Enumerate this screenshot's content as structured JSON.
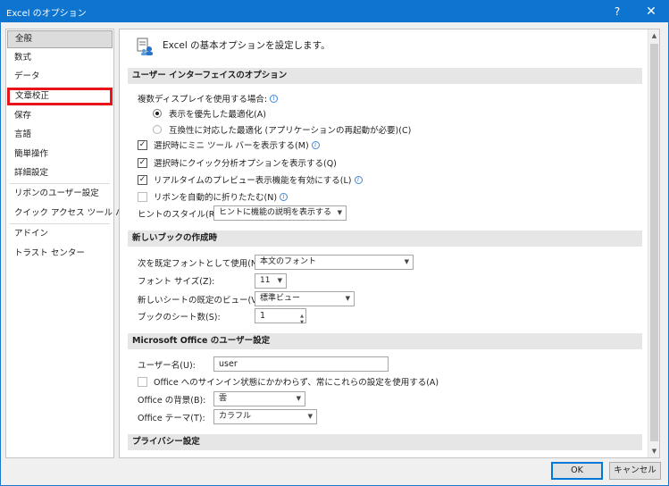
{
  "window": {
    "title": "Excel のオプション",
    "help_glyph": "?",
    "close_glyph": "✕"
  },
  "sidebar": {
    "items": [
      {
        "label": "全般",
        "selected": true
      },
      {
        "label": "数式"
      },
      {
        "label": "データ"
      },
      {
        "label": "文章校正",
        "highlighted": true
      },
      {
        "label": "保存"
      },
      {
        "label": "言語"
      },
      {
        "label": "簡単操作"
      },
      {
        "label": "詳細設定"
      },
      {
        "label": "リボンのユーザー設定"
      },
      {
        "label": "クイック アクセス ツール バー"
      },
      {
        "label": "アドイン"
      },
      {
        "label": "トラスト センター"
      }
    ]
  },
  "content": {
    "header": "Excel の基本オプションを設定します。",
    "ui_section": {
      "title": "ユーザー インターフェイスのオプション",
      "multi_display_label": "複数ディスプレイを使用する場合:",
      "radio_optimize_display": "表示を優先した最適化(A)",
      "radio_optimize_compat": "互換性に対応した最適化 (アプリケーションの再起動が必要)(C)",
      "mini_toolbar": "選択時にミニ ツール バーを表示する(M)",
      "quick_analysis": "選択時にクイック分析オプションを表示する(Q)",
      "live_preview": "リアルタイムのプレビュー表示機能を有効にする(L)",
      "collapse_ribbon": "リボンを自動的に折りたたむ(N)",
      "tooltip_style_label": "ヒントのスタイル(R):",
      "tooltip_style_value": "ヒントに機能の説明を表示する"
    },
    "new_book_section": {
      "title": "新しいブックの作成時",
      "default_font_label": "次を既定フォントとして使用(N):",
      "default_font_value": "本文のフォント",
      "font_size_label": "フォント サイズ(Z):",
      "font_size_value": "11",
      "default_view_label": "新しいシートの既定のビュー(V):",
      "default_view_value": "標準ビュー",
      "sheet_count_label": "ブックのシート数(S):",
      "sheet_count_value": "1"
    },
    "office_section": {
      "title": "Microsoft Office のユーザー設定",
      "username_label": "ユーザー名(U):",
      "username_value": "user",
      "always_use_values": "Office へのサインイン状態にかかわらず、常にこれらの設定を使用する(A)",
      "background_label": "Office の背景(B):",
      "background_value": "雲",
      "theme_label": "Office テーマ(T):",
      "theme_value": "カラフル"
    },
    "privacy_section": {
      "title": "プライバシー設定"
    }
  },
  "buttons": {
    "ok": "OK",
    "cancel": "キャンセル"
  },
  "icons": {
    "dropdown": "▼",
    "spin_up": "▲",
    "spin_down": "▼",
    "scroll_up": "▲",
    "scroll_down": "▼",
    "info": "i",
    "checkmark": "✓"
  },
  "colors": {
    "titlebar": "#0d74d0",
    "highlight_border": "#e8141c"
  }
}
